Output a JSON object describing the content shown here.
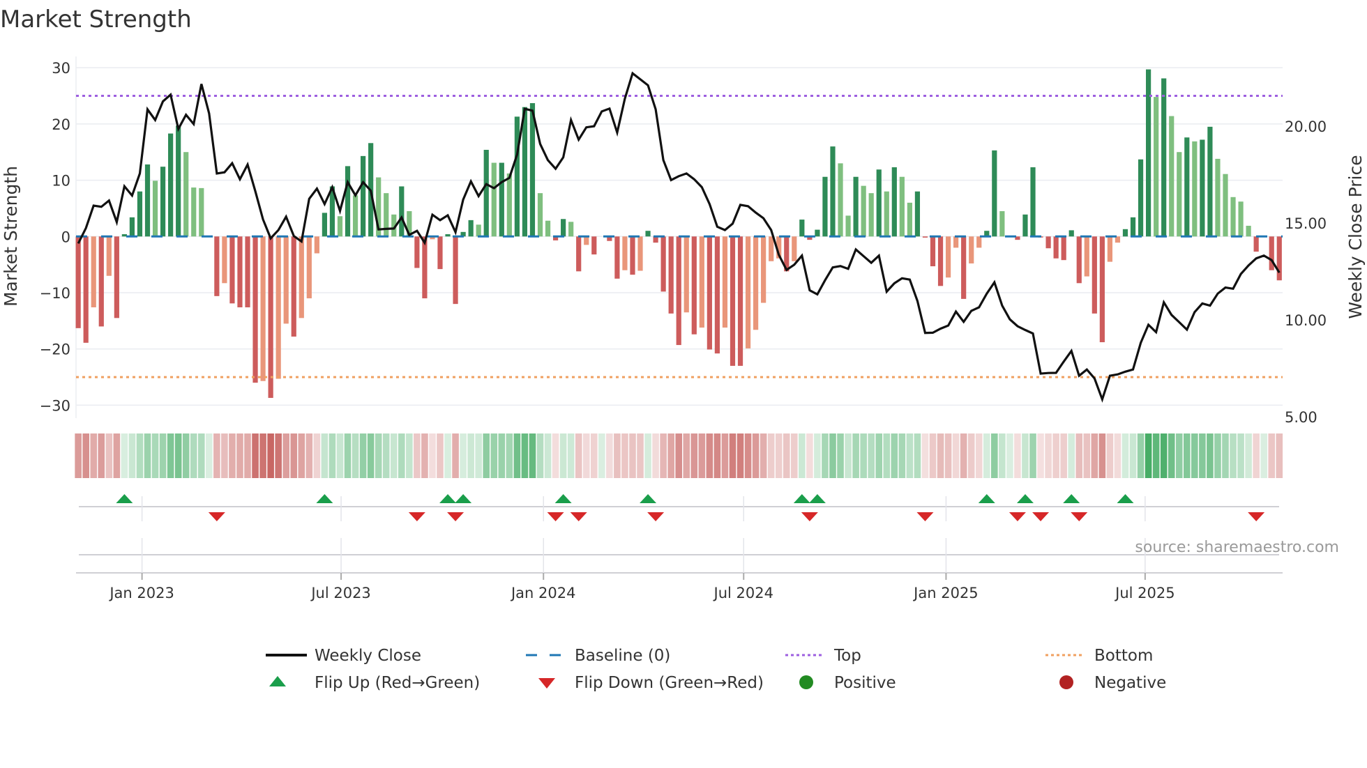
{
  "title": "Market Strength",
  "source": "source: sharemaestro.com",
  "colors": {
    "bar_pos_strong": "#2e8b57",
    "bar_pos_weak": "#7fbf7f",
    "bar_neg_strong": "#cd5c5c",
    "bar_neg_weak": "#e9967a",
    "heat_pos": "#31a354",
    "heat_neg": "#c0504d",
    "line": "#111111",
    "baseline": "#1f77b4",
    "top": "#9d5fe0",
    "bottom": "#f0a060",
    "flip_up": "#1a9e4b",
    "flip_down": "#d62728",
    "positive": "#228b22",
    "negative": "#b22222"
  },
  "chart_data": {
    "type": "bar",
    "title": "Market Strength",
    "xlabel": "",
    "ylabel": "Market Strength",
    "y2label": "Weekly Close Price",
    "frequency": "weekly",
    "start_date": "2022-11-04",
    "xlim": [
      "2022-11-02",
      "2025-11-03"
    ],
    "ylim": [
      -32.3,
      32.0
    ],
    "y2lim": [
      4.93,
      23.6
    ],
    "grid": true,
    "yticks": [
      30,
      20,
      10,
      0,
      -10,
      -20,
      -30
    ],
    "ytick_labels": [
      "30",
      "20",
      "10",
      "0",
      "−10",
      "−20",
      "−30"
    ],
    "y2ticks": [
      20,
      15,
      10,
      5
    ],
    "y2tick_labels": [
      "20.00",
      "15.00",
      "10.00",
      "5.00"
    ],
    "xticks": [
      "2023-01-01",
      "2023-07-01",
      "2024-01-01",
      "2024-07-01",
      "2025-01-01",
      "2025-07-01"
    ],
    "xtick_labels": [
      "Jan 2023",
      "Jul 2023",
      "Jan 2024",
      "Jul 2024",
      "Jan 2025",
      "Jul 2025"
    ],
    "top_level": 25,
    "bottom_level": -25,
    "baseline": 0,
    "strength": [
      -16.3,
      -18.9,
      -12.6,
      -16.0,
      -7.0,
      -14.5,
      0.4,
      3.4,
      8.0,
      12.8,
      9.9,
      12.4,
      18.3,
      19.7,
      15.0,
      8.7,
      8.6,
      0,
      -10.6,
      -8.3,
      -11.9,
      -12.6,
      -12.6,
      -26.0,
      -25.7,
      -28.7,
      -25.3,
      -15.5,
      -17.8,
      -14.5,
      -11.0,
      -3.0,
      4.2,
      8.9,
      3.6,
      12.5,
      7.3,
      14.3,
      16.6,
      10.5,
      7.7,
      3.9,
      8.9,
      4.5,
      -5.6,
      -11.0,
      -0.5,
      -5.8,
      0.4,
      -12.0,
      0.8,
      2.9,
      2.1,
      15.4,
      13.1,
      13.1,
      11.2,
      21.3,
      23.0,
      23.7,
      7.7,
      2.8,
      -0.7,
      3.1,
      2.6,
      -6.2,
      -1.5,
      -3.2,
      0,
      -0.8,
      -7.5,
      -6.0,
      -6.8,
      -6.1,
      1.0,
      -1.1,
      -9.8,
      -13.7,
      -19.3,
      -13.5,
      -17.4,
      -16.2,
      -20.1,
      -20.8,
      -16.2,
      -23.0,
      -23.0,
      -19.9,
      -16.6,
      -11.8,
      -4.4,
      -3.9,
      -6.2,
      -4.4,
      3.0,
      -0.6,
      1.2,
      10.6,
      16.0,
      13.0,
      3.7,
      10.6,
      9.0,
      7.7,
      11.9,
      8.0,
      12.3,
      10.6,
      6.0,
      8.0,
      -0.2,
      -5.3,
      -8.8,
      -7.3,
      -2.0,
      -11.1,
      -4.8,
      -2.0,
      1.0,
      15.3,
      4.5,
      0,
      -0.6,
      3.9,
      12.3,
      -0.1,
      -2.1,
      -3.9,
      -4.2,
      1.1,
      -8.3,
      -7.1,
      -13.7,
      -18.8,
      -4.5,
      -1.1,
      1.3,
      3.4,
      13.7,
      29.7,
      24.8,
      28.1,
      21.4,
      15.0,
      17.6,
      16.9,
      17.2,
      19.5,
      13.8,
      11.1,
      7.0,
      6.2,
      1.9,
      -2.7,
      0,
      -6.0,
      -7.8
    ],
    "weekly_close": [
      13.95,
      14.74,
      15.9,
      15.84,
      16.16,
      15.05,
      16.9,
      16.42,
      17.56,
      20.87,
      20.32,
      21.28,
      21.63,
      19.86,
      20.59,
      20.11,
      22.18,
      20.66,
      17.56,
      17.62,
      18.09,
      17.26,
      18.02,
      16.64,
      15.19,
      14.21,
      14.64,
      15.33,
      14.33,
      14.05,
      16.25,
      16.78,
      15.98,
      16.85,
      15.63,
      17.11,
      16.43,
      17.11,
      16.67,
      14.67,
      14.7,
      14.72,
      15.29,
      14.39,
      14.6,
      13.98,
      15.43,
      15.15,
      15.4,
      14.53,
      16.21,
      17.15,
      16.39,
      17.01,
      16.8,
      17.11,
      17.33,
      18.53,
      20.9,
      20.8,
      19.08,
      18.25,
      17.8,
      18.39,
      20.32,
      19.31,
      19.94,
      20.0,
      20.76,
      20.91,
      19.67,
      21.42,
      22.73,
      22.42,
      22.11,
      20.87,
      18.25,
      17.22,
      17.42,
      17.56,
      17.26,
      16.85,
      15.98,
      14.81,
      14.64,
      14.97,
      15.94,
      15.87,
      15.54,
      15.25,
      14.64,
      13.36,
      12.58,
      12.85,
      13.32,
      11.53,
      11.32,
      12.05,
      12.71,
      12.78,
      12.64,
      13.64,
      13.29,
      12.95,
      13.32,
      11.46,
      11.89,
      12.15,
      12.08,
      10.98,
      9.33,
      9.34,
      9.55,
      9.71,
      10.43,
      9.9,
      10.47,
      10.65,
      11.36,
      11.94,
      10.74,
      10.03,
      9.68,
      9.48,
      9.3,
      7.23,
      7.26,
      7.27,
      7.85,
      8.4,
      7.12,
      7.44,
      6.98,
      5.9,
      7.12,
      7.19,
      7.33,
      7.44,
      8.82,
      9.75,
      9.37,
      10.91,
      10.26,
      9.88,
      9.5,
      10.4,
      10.85,
      10.74,
      11.36,
      11.67,
      11.61,
      12.37,
      12.81,
      13.18,
      13.32,
      13.09,
      12.44
    ],
    "flip_up_weeks": [
      7,
      33,
      49,
      51,
      64,
      75,
      95,
      97,
      119,
      124,
      130,
      137
    ],
    "flip_down_weeks": [
      19,
      45,
      50,
      63,
      66,
      76,
      96,
      111,
      123,
      126,
      131,
      154
    ]
  },
  "legend": {
    "position": "bottom",
    "items": [
      {
        "label": "Weekly Close",
        "icon": "solid-line"
      },
      {
        "label": "Baseline (0)",
        "icon": "dashed-line"
      },
      {
        "label": "Top",
        "icon": "dotted-line"
      },
      {
        "label": "Bottom",
        "icon": "dotted-line"
      },
      {
        "label": "Flip Up (Red→Green)",
        "icon": "triangle-up"
      },
      {
        "label": "Flip Down (Green→Red)",
        "icon": "triangle-down"
      },
      {
        "label": "Positive",
        "icon": "circle"
      },
      {
        "label": "Negative",
        "icon": "circle"
      }
    ]
  }
}
